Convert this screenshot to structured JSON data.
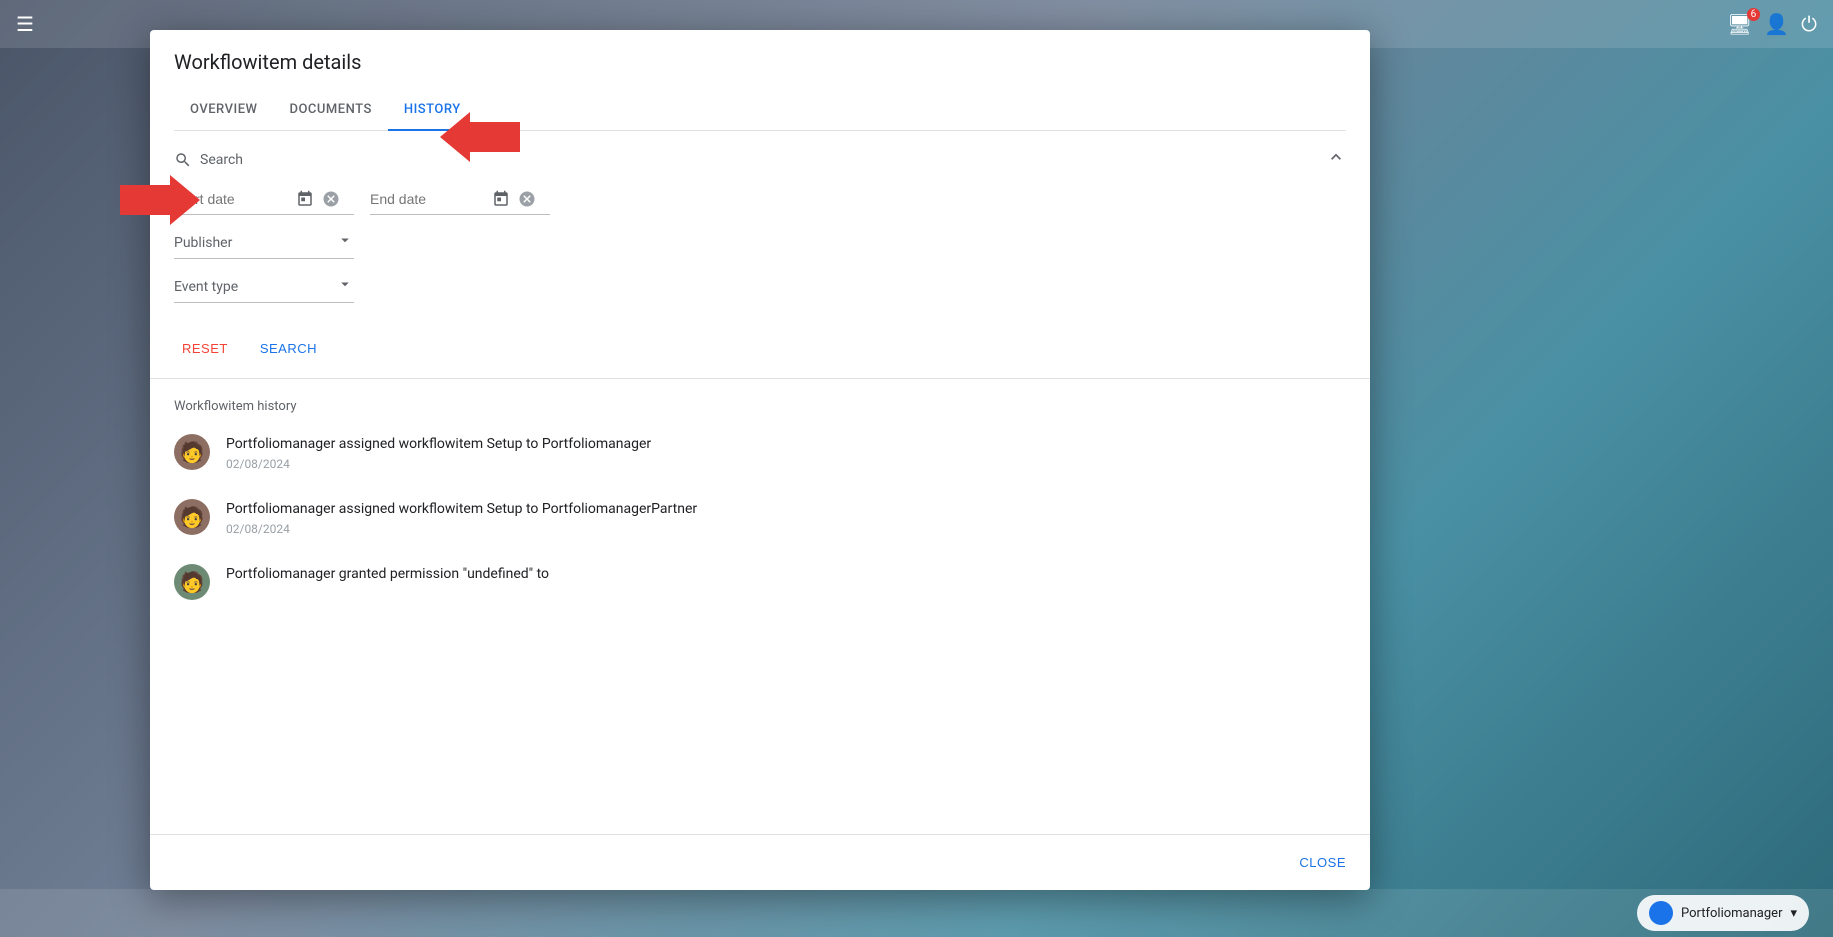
{
  "dialog": {
    "title": "Workflowitem details",
    "tabs": [
      {
        "id": "overview",
        "label": "OVERVIEW",
        "active": false
      },
      {
        "id": "documents",
        "label": "DOCUMENTS",
        "active": false
      },
      {
        "id": "history",
        "label": "HISTORY",
        "active": true
      }
    ],
    "search": {
      "label": "Search",
      "collapsed": false,
      "startDate": {
        "placeholder": "Start date"
      },
      "endDate": {
        "placeholder": "End date"
      },
      "publisher": {
        "label": "Publisher"
      },
      "eventType": {
        "label": "Event type"
      },
      "resetLabel": "RESET",
      "searchLabel": "SEARCH"
    },
    "history": {
      "title": "Workflowitem history",
      "items": [
        {
          "text": "Portfoliomanager assigned workflowitem Setup to Portfoliomanager",
          "date": "02/08/2024"
        },
        {
          "text": "Portfoliomanager assigned workflowitem Setup to PortfoliomanagerPartner",
          "date": "02/08/2024"
        },
        {
          "text": "Portfoliomanager granted permission \"undefined\" to",
          "date": ""
        }
      ]
    },
    "footer": {
      "closeLabel": "CLOSE"
    }
  },
  "topbar": {
    "menuIcon": "☰",
    "notificationCount": "6",
    "icons": [
      "monitor-icon",
      "person-icon",
      "power-icon"
    ]
  },
  "bottombar": {
    "portfolioLabel": "Portfoliomanager",
    "dropdownIcon": "▾"
  }
}
